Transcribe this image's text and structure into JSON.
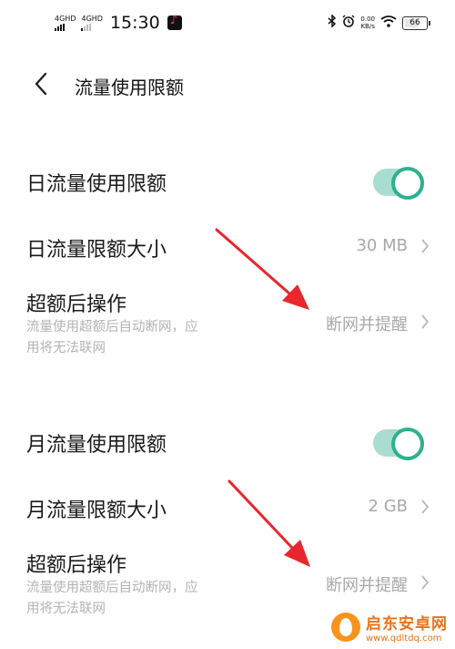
{
  "status_bar": {
    "net1": "4G",
    "net1_sup": "HD",
    "net2": "4G",
    "net2_sup": "HD",
    "time": "15:30",
    "speed_value": "0.00",
    "speed_unit": "KB/s",
    "battery": "66"
  },
  "header": {
    "title": "流量使用限额"
  },
  "daily": {
    "limit_toggle_label": "日流量使用限额",
    "limit_toggle_on": true,
    "size_label": "日流量限额大小",
    "size_value": "30 MB",
    "action_label": "超额后操作",
    "action_desc": "流量使用超额后自动断网，应用将无法联网",
    "action_value": "断网并提醒"
  },
  "monthly": {
    "limit_toggle_label": "月流量使用限额",
    "limit_toggle_on": true,
    "size_label": "月流量限额大小",
    "size_value": "2 GB",
    "action_label": "超额后操作",
    "action_desc": "流量使用超额后自动断网，应用将无法联网",
    "action_value": "断网并提醒"
  },
  "watermark": {
    "name": "启东安卓网",
    "url": "www.qdltdq.com"
  },
  "colors": {
    "toggle_track": "#a9ddd0",
    "toggle_knob_border": "#2db18e",
    "annotation_arrow": "#e8262c",
    "watermark": "#e8731a"
  }
}
